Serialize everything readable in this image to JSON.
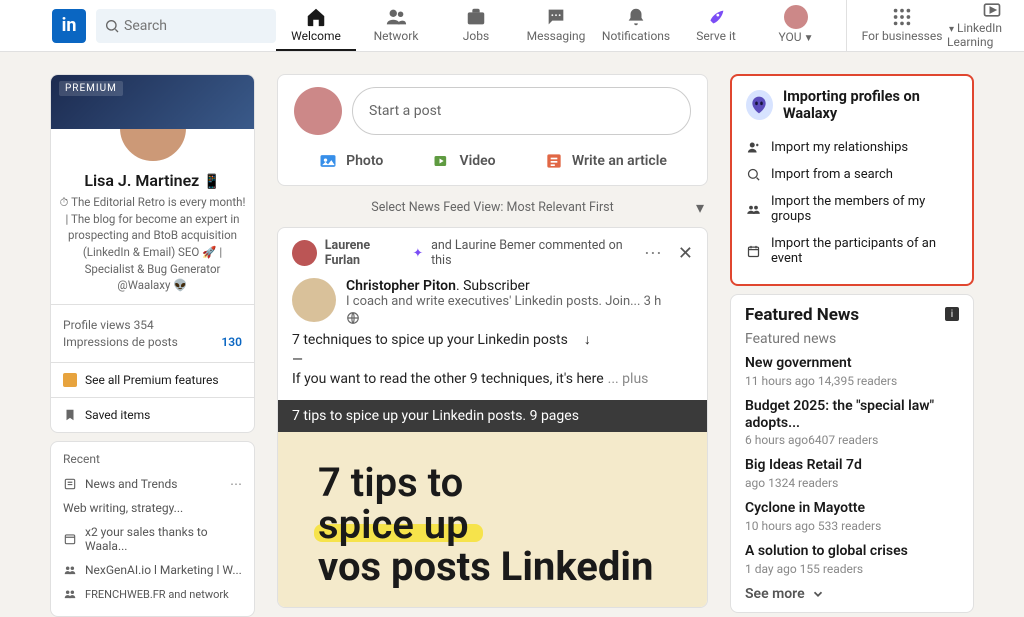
{
  "header": {
    "search_placeholder": "Search",
    "nav": {
      "welcome": "Welcome",
      "network": "Network",
      "jobs": "Jobs",
      "messaging": "Messaging",
      "notifications": "Notifications",
      "serve": "Serve it",
      "you": "YOU",
      "businesses": "For businesses",
      "learning": "LinkedIn Learning"
    }
  },
  "profile": {
    "premium_tag": "PREMIUM",
    "name": "Lisa J. Martinez",
    "tagline": "⏱ The Editorial Retro is every month! | The blog for\nbecome an expert in prospecting and BtoB acquisition (LinkedIn & Email) SEO 🚀  |   Specialist & Bug Generator @Waalaxy  👽",
    "stats": {
      "views_label": "Profile views",
      "views_value": "354",
      "impressions_label": "Impressions de posts",
      "impressions_value": "130"
    },
    "premium_link": "See all Premium features",
    "saved_label": "Saved items"
  },
  "recent": {
    "heading": "Recent",
    "items": [
      "News and Trends",
      "Web writing, strategy...",
      "x2 your sales thanks to Waala...",
      "NexGenAI.io l Marketing l W...",
      "FRENCHWEB.FR and network"
    ]
  },
  "compose": {
    "start": "Start a post",
    "photo": "Photo",
    "video": "Video",
    "article": "Write an article"
  },
  "feed_selector": "Select News Feed View: Most Relevant First",
  "post": {
    "commenter": "Laurene Furlan",
    "comment_meta": "and Laurine Bemer commented on this",
    "author": "Christopher Piton",
    "author_sfx": ". Subscriber",
    "subline": "I coach and write executives' Linkedin posts. Join... 3 h",
    "line1": "7 techniques to spice up your Linkedin posts",
    "line2": "If you want to read the other 9 techniques, it's here",
    "more": "... plus",
    "banner": "7 tips to spice up your Linkedin posts. 9 pages",
    "img_l1": "7 tips to",
    "img_l2": "spice up",
    "img_l3": "vos posts Linkedin"
  },
  "waalaxy": {
    "title": "Importing profiles on Waalaxy",
    "items": [
      "Import my relationships",
      "Import from a search",
      "Import the members of my groups",
      "Import the participants of an event"
    ]
  },
  "news": {
    "heading": "Featured News",
    "subheading": "Featured news",
    "items": [
      {
        "t": "New government",
        "m": "11 hours ago 14,395 readers"
      },
      {
        "t": "Budget 2025: the \"special law\" adopts...",
        "m": "6 hours ago6407 readers"
      },
      {
        "t": "Big Ideas Retail 7d",
        "m": "ago 1324 readers"
      },
      {
        "t": "Cyclone in Mayotte",
        "m": "10 hours ago 533 readers"
      },
      {
        "t": "A solution to global crises",
        "m": "1 day ago 155 readers"
      }
    ],
    "see_more": "See more"
  }
}
